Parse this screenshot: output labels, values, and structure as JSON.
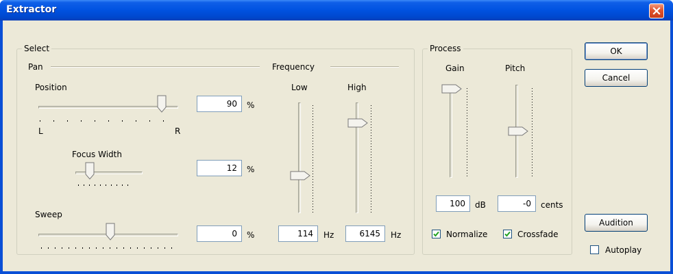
{
  "window": {
    "title": "Extractor"
  },
  "select": {
    "group_label": "Select",
    "pan_label": "Pan",
    "position": {
      "label": "Position",
      "value": "90",
      "unit": "%",
      "slider_percent": 90,
      "left_label": "L",
      "right_label": "R"
    },
    "focus_width": {
      "label": "Focus Width",
      "value": "12",
      "unit": "%",
      "slider_percent": 12
    },
    "sweep": {
      "label": "Sweep",
      "value": "0",
      "unit": "%",
      "slider_percent": 50
    },
    "frequency": {
      "label": "Frequency",
      "low": {
        "label": "Low",
        "value": "114",
        "unit": "Hz",
        "slider_percent": 30
      },
      "high": {
        "label": "High",
        "value": "6145",
        "unit": "Hz",
        "slider_percent": 85
      }
    }
  },
  "process": {
    "group_label": "Process",
    "gain": {
      "label": "Gain",
      "value": "100",
      "unit": "dB",
      "slider_percent": 100
    },
    "pitch": {
      "label": "Pitch",
      "value": "-0",
      "unit": "cents",
      "slider_percent": 50
    },
    "normalize": {
      "label": "Normalize",
      "checked": true
    },
    "crossfade": {
      "label": "Crossfade",
      "checked": true
    }
  },
  "buttons": {
    "ok": "OK",
    "cancel": "Cancel",
    "audition": "Audition"
  },
  "autoplay": {
    "label": "Autoplay",
    "checked": false
  },
  "colors": {
    "titlebar": "#0052e0",
    "face": "#ece9d8",
    "close": "#e1532e",
    "field_border": "#7f9db9"
  }
}
